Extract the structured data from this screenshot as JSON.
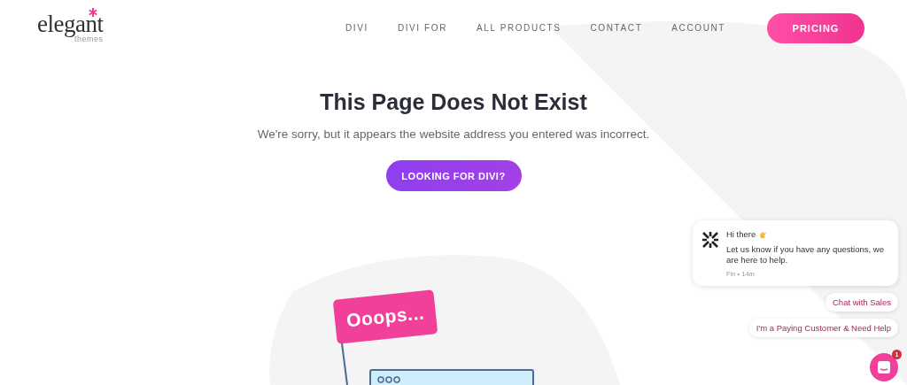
{
  "logo": {
    "wordmark": "elegant",
    "tagline": "themes"
  },
  "nav": {
    "links": [
      "DIVI",
      "DIVI FOR",
      "ALL PRODUCTS",
      "CONTACT",
      "ACCOUNT"
    ],
    "cta": "PRICING"
  },
  "error": {
    "title": "This Page Does Not Exist",
    "message": "We're sorry, but it appears the website address you entered was incorrect.",
    "button": "LOOKING FOR DIVI?"
  },
  "illustration": {
    "flag_text": "Ooops..."
  },
  "chat": {
    "greeting": "Hi there",
    "message": "Let us know if you have any questions, we are here to help.",
    "meta": "Fin • 14m",
    "replies": [
      "Chat with Sales",
      "I'm a Paying Customer & Need Help"
    ],
    "badge": "1"
  }
}
